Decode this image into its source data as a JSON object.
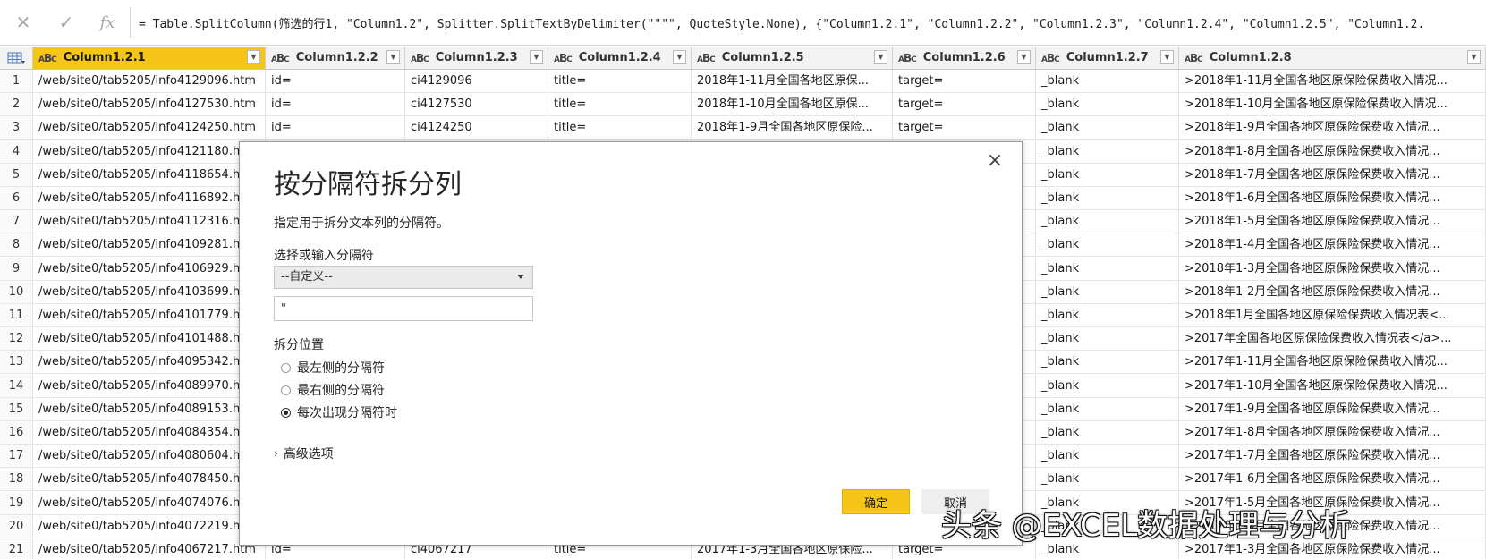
{
  "formula_bar": {
    "cancel_icon": "close-icon",
    "commit_icon": "check-icon",
    "fx_label": "fx",
    "formula": "= Table.SplitColumn(筛选的行1, \"Column1.2\", Splitter.SplitTextByDelimiter(\"\"\"\", QuoteStyle.None), {\"Column1.2.1\", \"Column1.2.2\", \"Column1.2.3\", \"Column1.2.4\", \"Column1.2.5\", \"Column1.2."
  },
  "grid": {
    "columns": [
      {
        "name": "Column1.2.1",
        "type_icon": "ABC",
        "selected": true
      },
      {
        "name": "Column1.2.2",
        "type_icon": "ABC"
      },
      {
        "name": "Column1.2.3",
        "type_icon": "ABC"
      },
      {
        "name": "Column1.2.4",
        "type_icon": "ABC"
      },
      {
        "name": "Column1.2.5",
        "type_icon": "ABC"
      },
      {
        "name": "Column1.2.6",
        "type_icon": "ABC"
      },
      {
        "name": "Column1.2.7",
        "type_icon": "ABC"
      },
      {
        "name": "Column1.2.8",
        "type_icon": "ABC"
      }
    ],
    "rows": [
      [
        "1",
        "/web/site0/tab5205/info4129096.htm",
        "id=",
        "ci4129096",
        "title=",
        "2018年1-11月全国各地区原保...",
        "target=",
        "_blank",
        ">2018年1-11月全国各地区原保险保费收入情况..."
      ],
      [
        "2",
        "/web/site0/tab5205/info4127530.htm",
        "id=",
        "ci4127530",
        "title=",
        "2018年1-10月全国各地区原保...",
        "target=",
        "_blank",
        ">2018年1-10月全国各地区原保险保费收入情况..."
      ],
      [
        "3",
        "/web/site0/tab5205/info4124250.htm",
        "id=",
        "ci4124250",
        "title=",
        "2018年1-9月全国各地区原保险...",
        "target=",
        "_blank",
        ">2018年1-9月全国各地区原保险保费收入情况..."
      ],
      [
        "4",
        "/web/site0/tab5205/info4121180.htm",
        "",
        "",
        "",
        "",
        "",
        "_blank",
        ">2018年1-8月全国各地区原保险保费收入情况..."
      ],
      [
        "5",
        "/web/site0/tab5205/info4118654.htm",
        "",
        "",
        "",
        "",
        "",
        "_blank",
        ">2018年1-7月全国各地区原保险保费收入情况..."
      ],
      [
        "6",
        "/web/site0/tab5205/info4116892.htm",
        "",
        "",
        "",
        "",
        "",
        "_blank",
        ">2018年1-6月全国各地区原保险保费收入情况..."
      ],
      [
        "7",
        "/web/site0/tab5205/info4112316.htm",
        "",
        "",
        "",
        "",
        "",
        "_blank",
        ">2018年1-5月全国各地区原保险保费收入情况..."
      ],
      [
        "8",
        "/web/site0/tab5205/info4109281.htm",
        "",
        "",
        "",
        "",
        "",
        "_blank",
        ">2018年1-4月全国各地区原保险保费收入情况..."
      ],
      [
        "9",
        "/web/site0/tab5205/info4106929.htm",
        "",
        "",
        "",
        "",
        "",
        "_blank",
        ">2018年1-3月全国各地区原保险保费收入情况..."
      ],
      [
        "10",
        "/web/site0/tab5205/info4103699.htm",
        "",
        "",
        "",
        "",
        "",
        "_blank",
        ">2018年1-2月全国各地区原保险保费收入情况..."
      ],
      [
        "11",
        "/web/site0/tab5205/info4101779.htm",
        "",
        "",
        "",
        "",
        "",
        "_blank",
        ">2018年1月全国各地区原保险保费收入情况表<..."
      ],
      [
        "12",
        "/web/site0/tab5205/info4101488.htm",
        "",
        "",
        "",
        "",
        "",
        "_blank",
        ">2017年全国各地区原保险保费收入情况表</a>..."
      ],
      [
        "13",
        "/web/site0/tab5205/info4095342.htm",
        "",
        "",
        "",
        "",
        "",
        "_blank",
        ">2017年1-11月全国各地区原保险保费收入情况..."
      ],
      [
        "14",
        "/web/site0/tab5205/info4089970.htm",
        "",
        "",
        "",
        "",
        "",
        "_blank",
        ">2017年1-10月全国各地区原保险保费收入情况..."
      ],
      [
        "15",
        "/web/site0/tab5205/info4089153.htm",
        "",
        "",
        "",
        "",
        "",
        "_blank",
        ">2017年1-9月全国各地区原保险保费收入情况..."
      ],
      [
        "16",
        "/web/site0/tab5205/info4084354.htm",
        "",
        "",
        "",
        "",
        "",
        "_blank",
        ">2017年1-8月全国各地区原保险保费收入情况..."
      ],
      [
        "17",
        "/web/site0/tab5205/info4080604.htm",
        "",
        "",
        "",
        "",
        "",
        "_blank",
        ">2017年1-7月全国各地区原保险保费收入情况..."
      ],
      [
        "18",
        "/web/site0/tab5205/info4078450.htm",
        "",
        "",
        "",
        "",
        "",
        "_blank",
        ">2017年1-6月全国各地区原保险保费收入情况..."
      ],
      [
        "19",
        "/web/site0/tab5205/info4074076.htm",
        "",
        "",
        "",
        "",
        "",
        "_blank",
        ">2017年1-5月全国各地区原保险保费收入情况..."
      ],
      [
        "20",
        "/web/site0/tab5205/info4072219.htm",
        "",
        "",
        "",
        "",
        "",
        "_blank",
        ">2017年1-4月全国各地区原保险保费收入情况..."
      ],
      [
        "21",
        "/web/site0/tab5205/info4067217.htm",
        "id=",
        "ci4067217",
        "title=",
        "2017年1-3月全国各地区原保险...",
        "target=",
        "_blank",
        ">2017年1-3月全国各地区原保险保费收入情况..."
      ]
    ]
  },
  "dialog": {
    "title": "按分隔符拆分列",
    "description": "指定用于拆分文本列的分隔符。",
    "separator_label": "选择或输入分隔符",
    "separator_selected": "--自定义--",
    "separator_value": "\"",
    "position_label": "拆分位置",
    "options": [
      {
        "label": "最左侧的分隔符",
        "checked": false
      },
      {
        "label": "最右侧的分隔符",
        "checked": false
      },
      {
        "label": "每次出现分隔符时",
        "checked": true
      }
    ],
    "advanced_label": "高级选项",
    "ok_label": "确定",
    "cancel_label": "取消"
  },
  "watermark": "头条 @EXCEL数据处理与分析",
  "colors": {
    "accent": "#f5c518"
  }
}
